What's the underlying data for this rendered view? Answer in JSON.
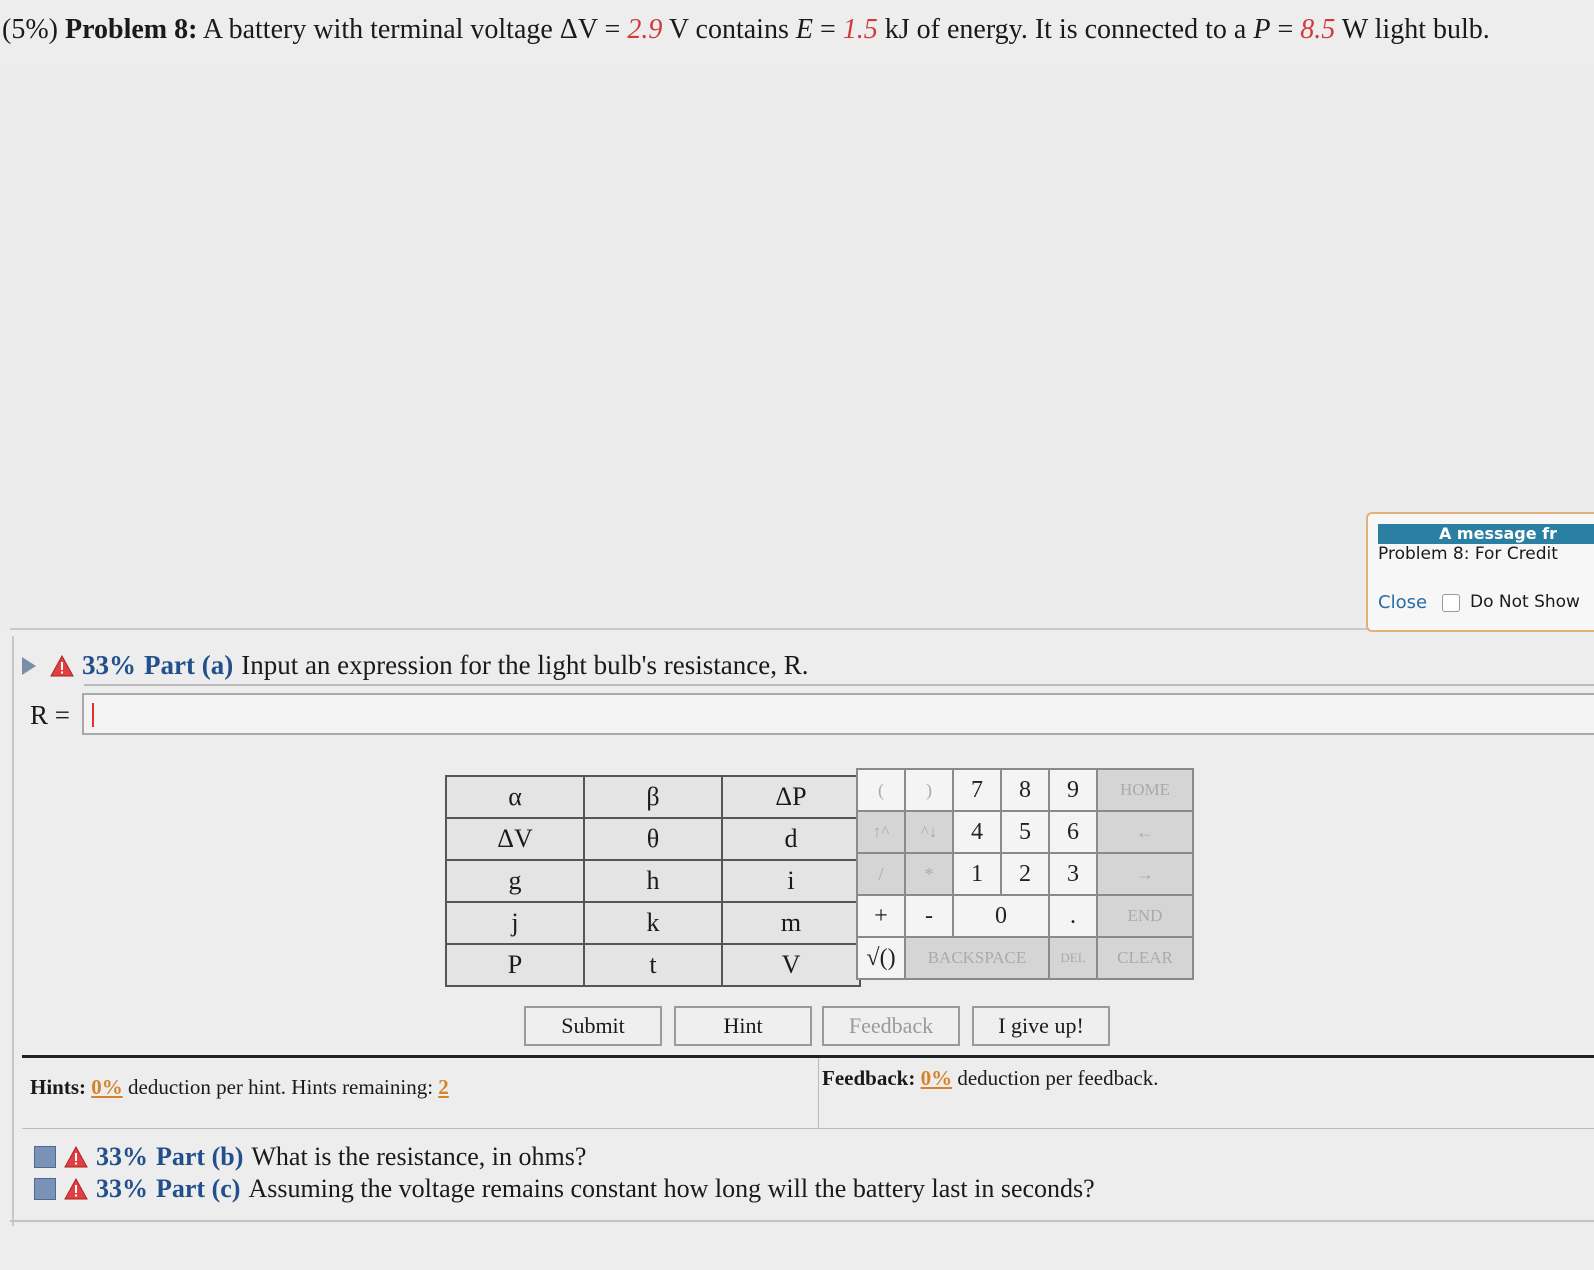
{
  "problem": {
    "weight": "(5%)",
    "label": "Problem 8:",
    "text_1": "A battery with terminal voltage ΔV = ",
    "voltage": "2.9",
    "text_2": " V contains ",
    "energy_var": "E",
    "text_3": " = ",
    "energy": "1.5",
    "text_4": " kJ of energy. It is connected to a ",
    "power_var": "P",
    "text_5": " = ",
    "power": "8.5",
    "text_6": " W light bulb."
  },
  "part_a": {
    "percent": "33%",
    "label": "Part (a)",
    "question": "Input an expression for the light bulb's resistance, R.",
    "input_label": "R =",
    "input_value": ""
  },
  "variable_keys": [
    [
      "α",
      "β",
      "ΔP"
    ],
    [
      "ΔV",
      "θ",
      "d"
    ],
    [
      "g",
      "h",
      "i"
    ],
    [
      "j",
      "k",
      "m"
    ],
    [
      "P",
      "t",
      "V"
    ]
  ],
  "keypad": {
    "open_paren": "(",
    "close_paren": ")",
    "k7": "7",
    "k8": "8",
    "k9": "9",
    "home": "HOME",
    "up_exp": "↑^",
    "down_exp": "^↓",
    "k4": "4",
    "k5": "5",
    "k6": "6",
    "left": "←",
    "divide": "/",
    "multiply": "*",
    "k1": "1",
    "k2": "2",
    "k3": "3",
    "right": "→",
    "plus": "+",
    "minus": "-",
    "k0": "0",
    "dot": ".",
    "end": "END",
    "sqrt": "√()",
    "backspace": "BACKSPACE",
    "del": "DEL",
    "clear": "CLEAR"
  },
  "buttons": {
    "submit": "Submit",
    "hint": "Hint",
    "feedback": "Feedback",
    "give_up": "I give up!"
  },
  "hints": {
    "label": "Hints:",
    "deduction": "0%",
    "text": "deduction per hint. Hints remaining:",
    "remaining": "2"
  },
  "feedback": {
    "label": "Feedback:",
    "deduction": "0%",
    "text": "deduction per feedback."
  },
  "part_b": {
    "percent": "33%",
    "label": "Part (b)",
    "question": "What is the resistance, in ohms?"
  },
  "part_c": {
    "percent": "33%",
    "label": "Part (c)",
    "question": "Assuming the voltage remains constant how long will the battery last in seconds?"
  },
  "message": {
    "title": "A message fr",
    "body": "Problem 8: For Credit",
    "close": "Close",
    "dont_show": "Do Not Show"
  }
}
